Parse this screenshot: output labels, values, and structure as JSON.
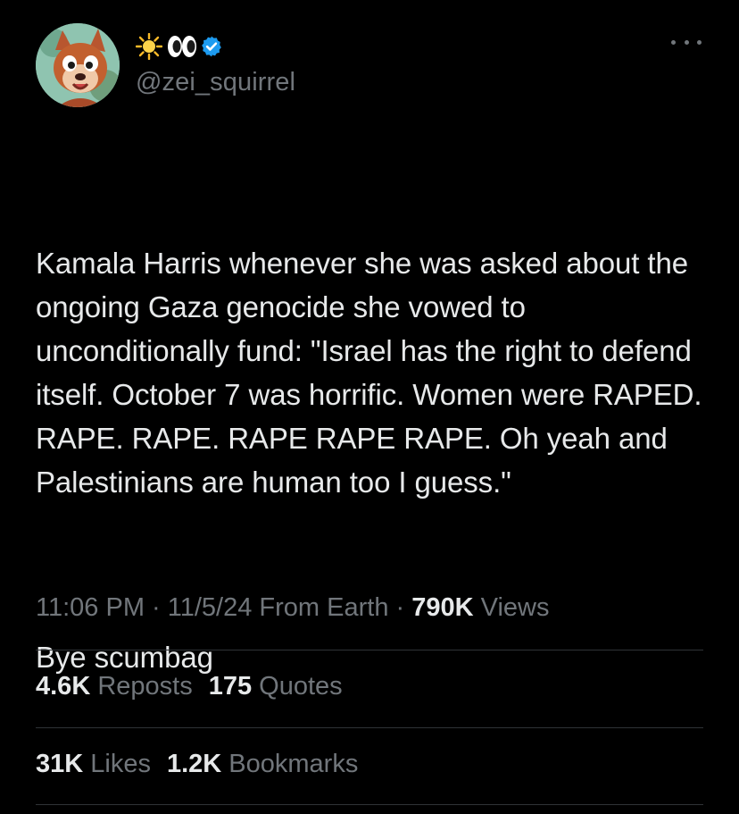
{
  "author": {
    "display_emojis": [
      "sun-emoji",
      "eyes-emoji"
    ],
    "verified": true,
    "handle": "@zei_squirrel"
  },
  "tweet": {
    "paragraph_1": "Kamala Harris whenever she was asked about the ongoing Gaza genocide she vowed to unconditionally fund: \"Israel has the right to defend itself. October 7 was horrific. Women were RAPED. RAPE. RAPE. RAPE RAPE RAPE. Oh yeah and Palestinians are human too I guess.\"",
    "paragraph_2": "Bye scumbag"
  },
  "meta": {
    "time": "11:06 PM",
    "sep1": " · ",
    "date": "11/5/24",
    "source": " From Earth",
    "sep2": " · ",
    "views_count": "790K",
    "views_label": " Views"
  },
  "stats": {
    "reposts_count": "4.6K",
    "reposts_label": " Reposts",
    "quotes_count": "175",
    "quotes_label": " Quotes",
    "likes_count": "31K",
    "likes_label": " Likes",
    "bookmarks_count": "1.2K",
    "bookmarks_label": " Bookmarks"
  },
  "colors": {
    "background": "#000000",
    "text": "#e7e9ea",
    "secondary": "#71767b",
    "divider": "#2f3336",
    "verified_blue": "#1d9bf0"
  }
}
